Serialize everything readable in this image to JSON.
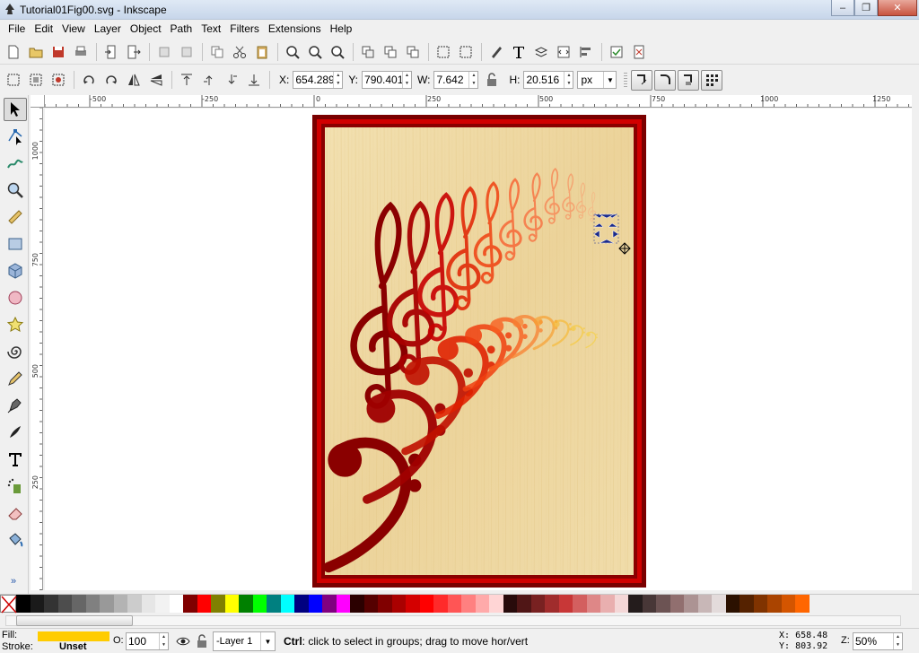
{
  "window": {
    "title": "Tutorial01Fig00.svg - Inkscape"
  },
  "menu": [
    {
      "label": "File"
    },
    {
      "label": "Edit"
    },
    {
      "label": "View"
    },
    {
      "label": "Layer"
    },
    {
      "label": "Object"
    },
    {
      "label": "Path"
    },
    {
      "label": "Text"
    },
    {
      "label": "Filters"
    },
    {
      "label": "Extensions"
    },
    {
      "label": "Help"
    }
  ],
  "controls": {
    "x_label": "X:",
    "x_value": "654.289",
    "y_label": "Y:",
    "y_value": "790.401",
    "w_label": "W:",
    "w_value": "7.642",
    "h_label": "H:",
    "h_value": "20.516",
    "unit": "px"
  },
  "rulers": {
    "horizontal": [
      "-500",
      "-250",
      "0",
      "250",
      "500",
      "750",
      "1000",
      "1250"
    ],
    "vertical": [
      "1000",
      "750",
      "500",
      "250"
    ]
  },
  "palette": {
    "colors": [
      "#000000",
      "#1a1a1a",
      "#333333",
      "#4d4d4d",
      "#666666",
      "#808080",
      "#999999",
      "#b3b3b3",
      "#cccccc",
      "#e6e6e6",
      "#f2f2f2",
      "#ffffff",
      "#800000",
      "#ff0000",
      "#808000",
      "#ffff00",
      "#008000",
      "#00ff00",
      "#008080",
      "#00ffff",
      "#000080",
      "#0000ff",
      "#800080",
      "#ff00ff",
      "#2b0000",
      "#550000",
      "#800000",
      "#aa0000",
      "#d40000",
      "#ff0000",
      "#ff2a2a",
      "#ff5555",
      "#ff8080",
      "#ffaaaa",
      "#ffd5d5",
      "#280b0b",
      "#501616",
      "#782121",
      "#a02c2c",
      "#c83737",
      "#d35f5f",
      "#de8787",
      "#e9afaf",
      "#f4d7d7",
      "#241c1c",
      "#483737",
      "#6c5353",
      "#916f6f",
      "#ac9393",
      "#c8b7b7",
      "#e3dbdb",
      "#2b1100",
      "#552200",
      "#803300",
      "#aa4400",
      "#d45500",
      "#ff6600"
    ]
  },
  "status": {
    "fill_label": "Fill:",
    "stroke_label": "Stroke:",
    "fill_color": "#ffcc00",
    "stroke_value": "Unset",
    "opacity_label": "O:",
    "opacity_value": "100",
    "layer": "-Layer 1",
    "message_key": "Ctrl",
    "message_text": ": click to select in groups; drag to move hor/vert",
    "cursor_x_label": "X:",
    "cursor_x": "658.48",
    "cursor_y_label": "Y:",
    "cursor_y": "803.92",
    "zoom_label": "Z:",
    "zoom": "50%"
  },
  "theme": {
    "frame_dark": "#7a0000",
    "frame_red": "#c80000",
    "wood": "#f0dba6",
    "selection": "#1a2a8a"
  }
}
